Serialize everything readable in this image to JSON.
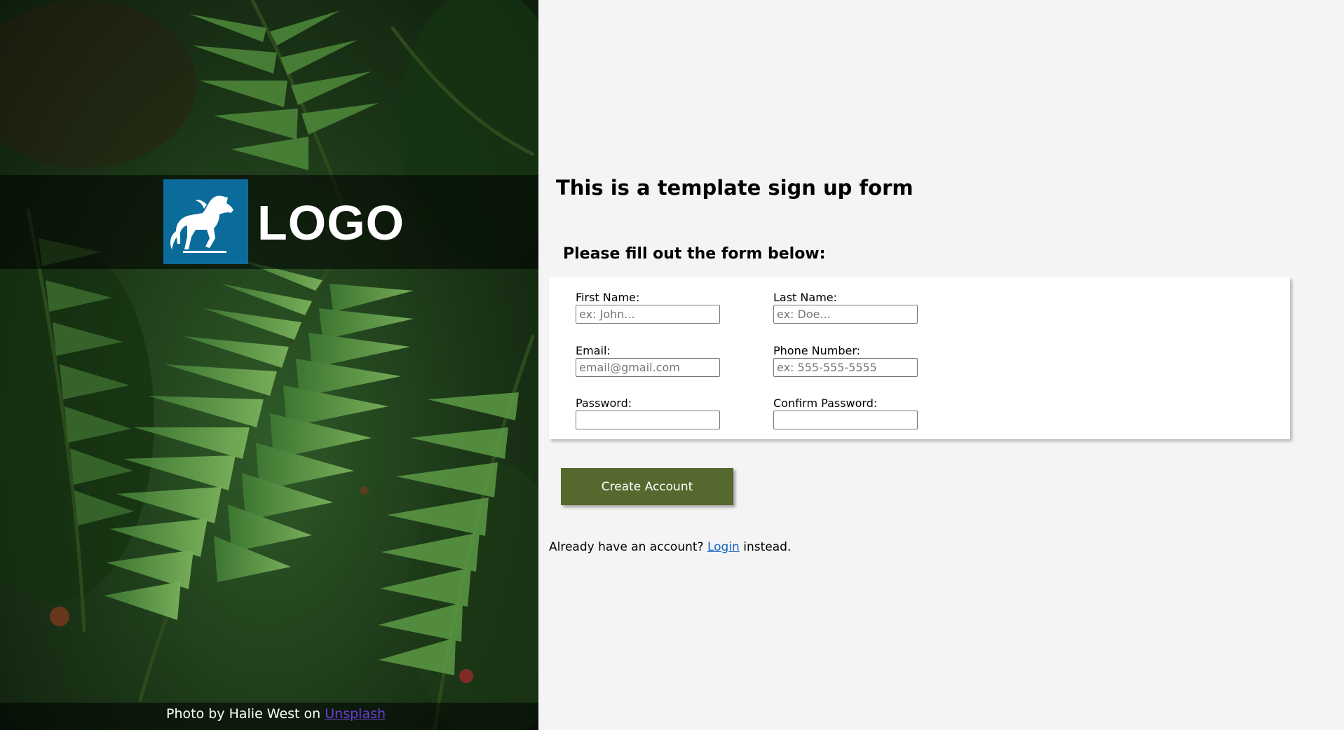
{
  "hero": {
    "logo_text": "LOGO",
    "credit_prefix": "Photo by Halie West on",
    "credit_link": "Unsplash"
  },
  "form": {
    "title": "This is a template sign up form",
    "subtitle": "Please fill out the form below:",
    "fields": {
      "first_name": {
        "label": "First Name:",
        "placeholder": "ex: John..."
      },
      "last_name": {
        "label": "Last Name:",
        "placeholder": "ex: Doe..."
      },
      "email": {
        "label": "Email:",
        "placeholder": "email@gmail.com"
      },
      "phone": {
        "label": "Phone Number:",
        "placeholder": "ex: 555-555-5555"
      },
      "password": {
        "label": "Password:",
        "placeholder": ""
      },
      "confirm_password": {
        "label": "Confirm Password:",
        "placeholder": ""
      }
    },
    "submit_label": "Create Account",
    "login_prompt": "Already have an account?",
    "login_link": "Login",
    "login_suffix": "instead."
  },
  "colors": {
    "logo_bg": "#0b6c9b",
    "button_bg": "#55682e",
    "page_bg": "#f4f4f4",
    "link": "#1565c0",
    "credit_link": "#6a3ddb"
  },
  "icons": {
    "logo": "horse-icon"
  }
}
